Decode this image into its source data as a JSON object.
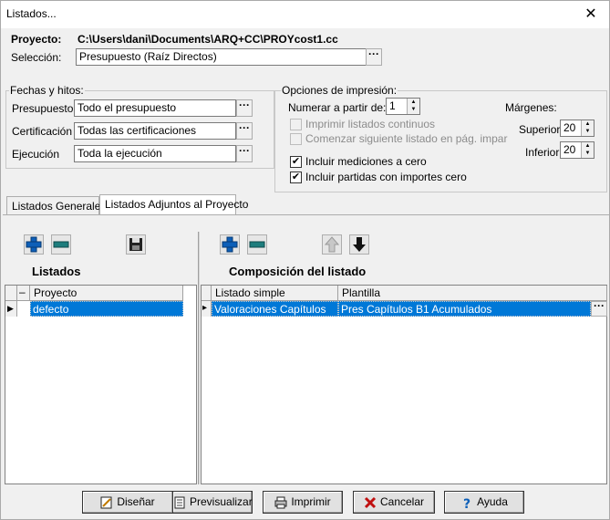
{
  "window": {
    "title": "Listados...",
    "close_symbol": "✕"
  },
  "project": {
    "label": "Proyecto:",
    "path": "C:\\Users\\dani\\Documents\\ARQ+CC\\PROYcost1.cc"
  },
  "selection": {
    "label": "Selección:",
    "value": "Presupuesto (Raíz Directos)"
  },
  "ellipsis": "···",
  "dates": {
    "title": "Fechas y hitos:",
    "presupuesto_label": "Presupuesto",
    "presupuesto_value": "Todo el presupuesto",
    "certificacion_label": "Certificación",
    "certificacion_value": "Todas las certificaciones",
    "ejecucion_label": "Ejecución",
    "ejecucion_value": "Toda la ejecución"
  },
  "print_options": {
    "title": "Opciones de impresión:",
    "numerar_label": "Numerar a partir de:",
    "numerar_value": "1",
    "opt_continuos": "Imprimir listados continuos",
    "opt_siguiente": "Comenzar siguiente listado en pág. impar",
    "opt_mediciones": "Incluir mediciones a cero",
    "opt_partidas": "Incluir partidas con importes cero",
    "check_mark": "✔",
    "margenes_label": "Márgenes:",
    "superior_label": "Superior",
    "superior_value": "20",
    "inferior_label": "Inferior",
    "inferior_value": "20"
  },
  "tabs": {
    "general": "Listados Generales",
    "adjuntos": "Listados Adjuntos al Proyecto"
  },
  "listados": {
    "title": "Listados",
    "col_expander": "–",
    "col_proyecto": "Proyecto",
    "row_marker": "▶",
    "rows": [
      "defecto"
    ]
  },
  "composicion": {
    "title": "Composición del listado",
    "col_listado": "Listado simple",
    "col_plantilla": "Plantilla",
    "row_marker": "▸",
    "rows": [
      {
        "listado": "Valoraciones Capítulos",
        "plantilla": "Pres Capítulos B1 Acumulados"
      }
    ]
  },
  "buttons": {
    "disenar": "Diseñar",
    "previsualizar": "Previsualizar",
    "imprimir": "Imprimir",
    "cancelar": "Cancelar",
    "ayuda": "Ayuda"
  },
  "colors": {
    "selection": "#0078d7",
    "plus_icon": "#0d5fb8",
    "minus_icon": "#1d7c7c",
    "cancel_icon": "#c01010"
  }
}
